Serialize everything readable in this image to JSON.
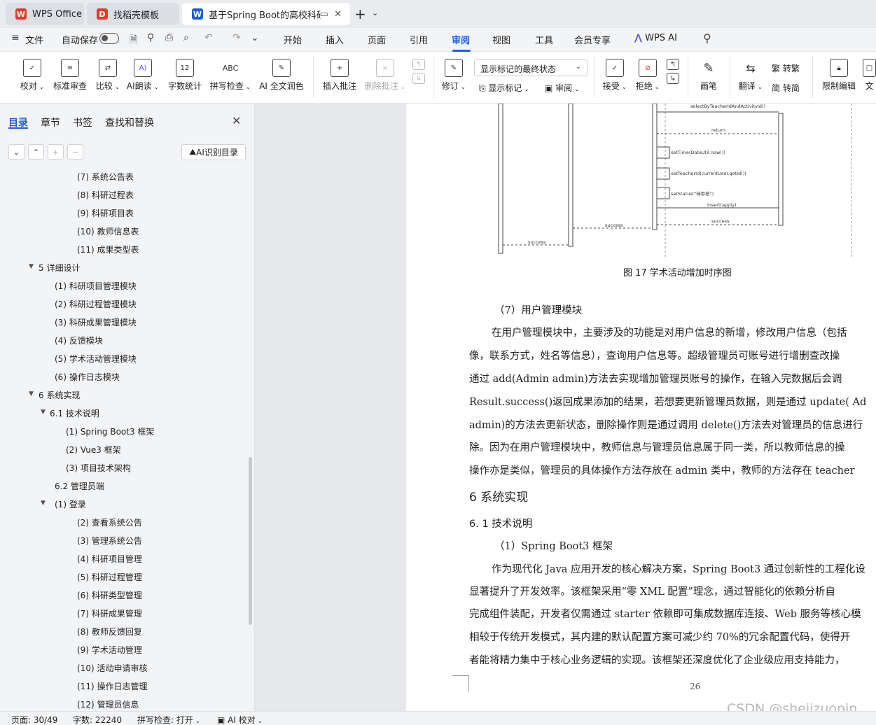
{
  "tabs": [
    {
      "label": "WPS Office",
      "logo": "W",
      "color": "#e33b2c"
    },
    {
      "label": "找稻壳模板",
      "logo": "D",
      "color": "#e33b2c"
    },
    {
      "label": "基于Spring Boot的高校科研f",
      "logo": "W",
      "color": "#1f5fdb"
    }
  ],
  "menubar": {
    "file": "文件",
    "autosave": "自动保存",
    "items": [
      "开始",
      "插入",
      "页面",
      "引用",
      "审阅",
      "视图",
      "工具",
      "会员专享",
      "WPS AI"
    ],
    "active": "审阅"
  },
  "ribbon": {
    "proofread": "校对",
    "standard_review": "标准审查",
    "compare": "比较",
    "ai_read": "AI朗读",
    "word_count": "字数统计",
    "spell_check": "拼写检查",
    "ai_polish": "AI 全文润色",
    "insert_comment": "插入批注",
    "delete_comment": "删除批注",
    "track_changes": "修订",
    "markup_dropdown": "显示标记的最终状态",
    "show_markup": "显示标记",
    "review": "审阅",
    "accept": "接受",
    "reject": "拒绝",
    "pen": "画笔",
    "translate": "翻译",
    "to_traditional": "转繁",
    "to_simplified": "转简",
    "restrict_edit": "限制编辑",
    "doc_more": "文"
  },
  "panel": {
    "tabs": [
      "目录",
      "章节",
      "书签",
      "查找和替换"
    ],
    "ai_toc": "AI识别目录",
    "toc": [
      {
        "label": "(7)  系统公告表",
        "level": 3
      },
      {
        "label": "(8)  科研过程表",
        "level": 3
      },
      {
        "label": "(9)  科研项目表",
        "level": 3
      },
      {
        "label": "(10)  教师信息表",
        "level": 3
      },
      {
        "label": "(11)  成果类型表",
        "level": 3
      },
      {
        "label": "5  详细设计",
        "level": 0,
        "arrow": true
      },
      {
        "label": "(1)  科研项目管理模块",
        "level": 1
      },
      {
        "label": "(2)  科研过程管理模块",
        "level": 1
      },
      {
        "label": "(3)  科研成果管理模块",
        "level": 1
      },
      {
        "label": "(4)  反馈模块",
        "level": 1
      },
      {
        "label": "(5)  学术活动管理模块",
        "level": 1
      },
      {
        "label": "(6)  操作日志模块",
        "level": 1
      },
      {
        "label": "6  系统实现",
        "level": 0,
        "arrow": true
      },
      {
        "label": "6.1  技术说明",
        "level": 1,
        "arrow": true
      },
      {
        "label": "(1)  Spring Boot3 框架",
        "level": 2
      },
      {
        "label": "(2)  Vue3 框架",
        "level": 2
      },
      {
        "label": "(3)  项目技术架构",
        "level": 2
      },
      {
        "label": "6.2  管理员端",
        "level": 1
      },
      {
        "label": "(1)  登录",
        "level": 1.5,
        "arrow": true
      },
      {
        "label": "(2)  查看系统公告",
        "level": 3
      },
      {
        "label": "(3)  管理系统公告",
        "level": 3
      },
      {
        "label": "(4)  科研项目管理",
        "level": 3
      },
      {
        "label": "(5)  科研过程管理",
        "level": 3
      },
      {
        "label": "(6)  科研类型管理",
        "level": 3
      },
      {
        "label": "(7)  科研成果管理",
        "level": 3
      },
      {
        "label": "(8)  教师反馈回复",
        "level": 3
      },
      {
        "label": "(9)  学术活动管理",
        "level": 3
      },
      {
        "label": "(10)  活动申请审核",
        "level": 3
      },
      {
        "label": "(11)  操作日志管理",
        "level": 3
      },
      {
        "label": "(12)  管理员信息",
        "level": 3
      }
    ]
  },
  "document": {
    "seq_labels": {
      "top": "selectByTeacherIdAndActivityId()",
      "return": "return",
      "set_time": "setTime(DateUtil.now())",
      "set_teacher": "setTeacherId(currentUser.getId())",
      "set_status": "setStatus(\"待审核\")",
      "insert": "insert(apply)",
      "success": "success"
    },
    "caption": "图 17  学术活动增加时序图",
    "lines": [
      "（7）用户管理模块",
      "在用户管理模块中，主要涉及的功能是对用户信息的新增，修改用户信息（包括",
      "像，联系方式，姓名等信息），查询用户信息等。超级管理员可账号进行增删查改操",
      "通过 add(Admin admin)方法去实现增加管理员账号的操作，在输入完数据后会调",
      "Result.success()返回成果添加的结果，若想要更新管理员数据，则是通过 update( Ad",
      "admin)的方法去更新状态，删除操作则是通过调用 delete()方法去对管理员的信息进行",
      "除。因为在用户管理模块中，教师信息与管理员信息属于同一类，所以教师信息的操",
      "操作亦是类似，管理员的具体操作方法存放在 admin 类中，教师的方法存在 teacher"
    ],
    "heading1": "6  系统实现",
    "heading2": "6. 1  技术说明",
    "lines2": [
      "（1）Spring Boot3 框架",
      "作为现代化 Java 应用开发的核心解决方案，Spring Boot3 通过创新性的工程化设",
      "显著提升了开发效率。该框架采用“零 XML 配置”理念，通过智能化的依赖分析自",
      "完成组件装配，开发者仅需通过 starter 依赖即可集成数据库连接、Web 服务等核心模",
      "相较于传统开发模式，其内建的默认配置方案可减少约 70%的冗余配置代码，使得开",
      "者能将精力集中于核心业务逻辑的实现。该框架还深度优化了企业级应用支持能力，"
    ],
    "page_number": "26"
  },
  "status": {
    "page": "页面: 30/49",
    "words": "字数: 22240",
    "spell": "拼写检查: 打开",
    "ai_check": "AI 校对"
  },
  "watermark": "CSDN @shejizuopin"
}
